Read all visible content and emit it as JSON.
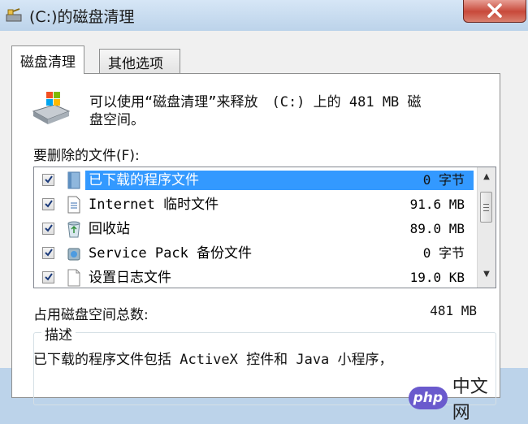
{
  "window": {
    "title": "(C:)的磁盘清理",
    "icon": "disk-cleanup-icon"
  },
  "tabs": [
    {
      "label": "磁盘清理",
      "active": true
    },
    {
      "label": "其他选项",
      "active": false
    }
  ],
  "summary": {
    "line1": "可以使用“磁盘清理”来释放　(C:) 上的 481 MB 磁",
    "line2": "盘空间。"
  },
  "files_label": "要删除的文件(F):",
  "files": [
    {
      "name": "已下载的程序文件",
      "size": "0 字节",
      "checked": true,
      "selected": true,
      "icon": "program-files-icon"
    },
    {
      "name": "Internet 临时文件",
      "size": "91.6 MB",
      "checked": true,
      "selected": false,
      "icon": "internet-files-icon"
    },
    {
      "name": "回收站",
      "size": "89.0 MB",
      "checked": true,
      "selected": false,
      "icon": "recycle-bin-icon"
    },
    {
      "name": "Service Pack 备份文件",
      "size": "0 字节",
      "checked": true,
      "selected": false,
      "icon": "service-pack-icon"
    },
    {
      "name": "设置日志文件",
      "size": "19.0 KB",
      "checked": true,
      "selected": false,
      "icon": "log-file-icon"
    }
  ],
  "total": {
    "label": "占用磁盘空间总数:",
    "value": "481 MB"
  },
  "description": {
    "group_title": "描述",
    "text": "已下载的程序文件包括 ActiveX 控件和 Java 小程序，"
  },
  "watermark": {
    "logo_text": "php",
    "text": "中文网"
  },
  "colors": {
    "selection": "#3399ff",
    "close_button": "#c8493a",
    "title_bar": "#bcd3ea"
  }
}
